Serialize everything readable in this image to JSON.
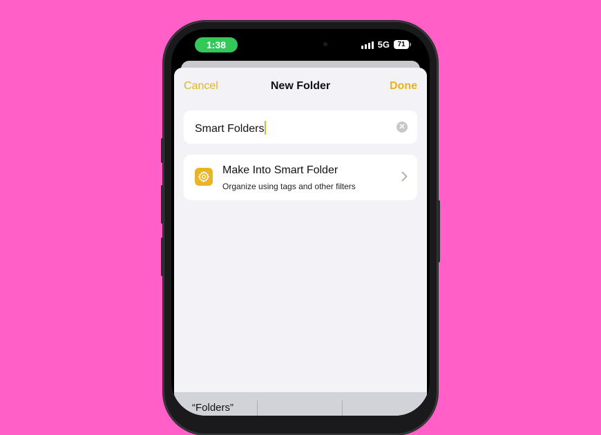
{
  "status_bar": {
    "time": "1:38",
    "network": "5G",
    "battery": "71"
  },
  "nav": {
    "cancel_label": "Cancel",
    "title": "New Folder",
    "done_label": "Done"
  },
  "folder_name": {
    "value": "Smart Folders"
  },
  "smart_folder_option": {
    "title": "Make Into Smart Folder",
    "subtitle": "Organize using tags and other filters"
  },
  "keyboard_suggestions": [
    "“Folders”",
    "",
    ""
  ],
  "colors": {
    "background": "#ff5fc6",
    "accent": "#e6b322",
    "time_pill": "#34c759"
  },
  "icons": [
    "gear-icon",
    "clear-icon",
    "chevron-right-icon",
    "signal-icon",
    "battery-icon"
  ]
}
